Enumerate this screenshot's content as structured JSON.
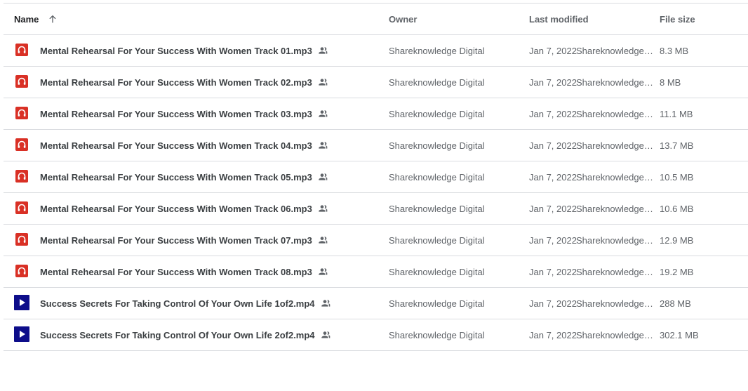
{
  "header": {
    "name": "Name",
    "owner": "Owner",
    "last_modified": "Last modified",
    "file_size": "File size"
  },
  "files": [
    {
      "type": "audio",
      "name": "Mental Rehearsal For Your Success With Women Track 01.mp3",
      "owner": "Shareknowledge Digital",
      "modified_date": "Jan 7, 2022",
      "modified_by": "Shareknowledge D...",
      "size": "8.3 MB"
    },
    {
      "type": "audio",
      "name": "Mental Rehearsal For Your Success With Women Track 02.mp3",
      "owner": "Shareknowledge Digital",
      "modified_date": "Jan 7, 2022",
      "modified_by": "Shareknowledge D...",
      "size": "8 MB"
    },
    {
      "type": "audio",
      "name": "Mental Rehearsal For Your Success With Women Track 03.mp3",
      "owner": "Shareknowledge Digital",
      "modified_date": "Jan 7, 2022",
      "modified_by": "Shareknowledge D...",
      "size": "11.1 MB"
    },
    {
      "type": "audio",
      "name": "Mental Rehearsal For Your Success With Women Track 04.mp3",
      "owner": "Shareknowledge Digital",
      "modified_date": "Jan 7, 2022",
      "modified_by": "Shareknowledge D...",
      "size": "13.7 MB"
    },
    {
      "type": "audio",
      "name": "Mental Rehearsal For Your Success With Women Track 05.mp3",
      "owner": "Shareknowledge Digital",
      "modified_date": "Jan 7, 2022",
      "modified_by": "Shareknowledge D...",
      "size": "10.5 MB"
    },
    {
      "type": "audio",
      "name": "Mental Rehearsal For Your Success With Women Track 06.mp3",
      "owner": "Shareknowledge Digital",
      "modified_date": "Jan 7, 2022",
      "modified_by": "Shareknowledge D...",
      "size": "10.6 MB"
    },
    {
      "type": "audio",
      "name": "Mental Rehearsal For Your Success With Women Track 07.mp3",
      "owner": "Shareknowledge Digital",
      "modified_date": "Jan 7, 2022",
      "modified_by": "Shareknowledge D...",
      "size": "12.9 MB"
    },
    {
      "type": "audio",
      "name": "Mental Rehearsal For Your Success With Women Track 08.mp3",
      "owner": "Shareknowledge Digital",
      "modified_date": "Jan 7, 2022",
      "modified_by": "Shareknowledge D...",
      "size": "19.2 MB"
    },
    {
      "type": "video",
      "name": "Success Secrets For Taking Control Of Your Own Life 1of2.mp4",
      "owner": "Shareknowledge Digital",
      "modified_date": "Jan 7, 2022",
      "modified_by": "Shareknowledge D...",
      "size": "288 MB"
    },
    {
      "type": "video",
      "name": "Success Secrets For Taking Control Of Your Own Life 2of2.mp4",
      "owner": "Shareknowledge Digital",
      "modified_date": "Jan 7, 2022",
      "modified_by": "Shareknowledge D...",
      "size": "302.1 MB"
    }
  ],
  "icons": {
    "audio": "audio-file-icon",
    "video": "video-file-icon",
    "shared": "shared-people-icon",
    "sort": "arrow-up-icon"
  },
  "colors": {
    "audio_icon": "#d93025",
    "video_icon": "#0d0d8a",
    "divider": "#dadce0",
    "secondary_text": "#5f6368"
  }
}
